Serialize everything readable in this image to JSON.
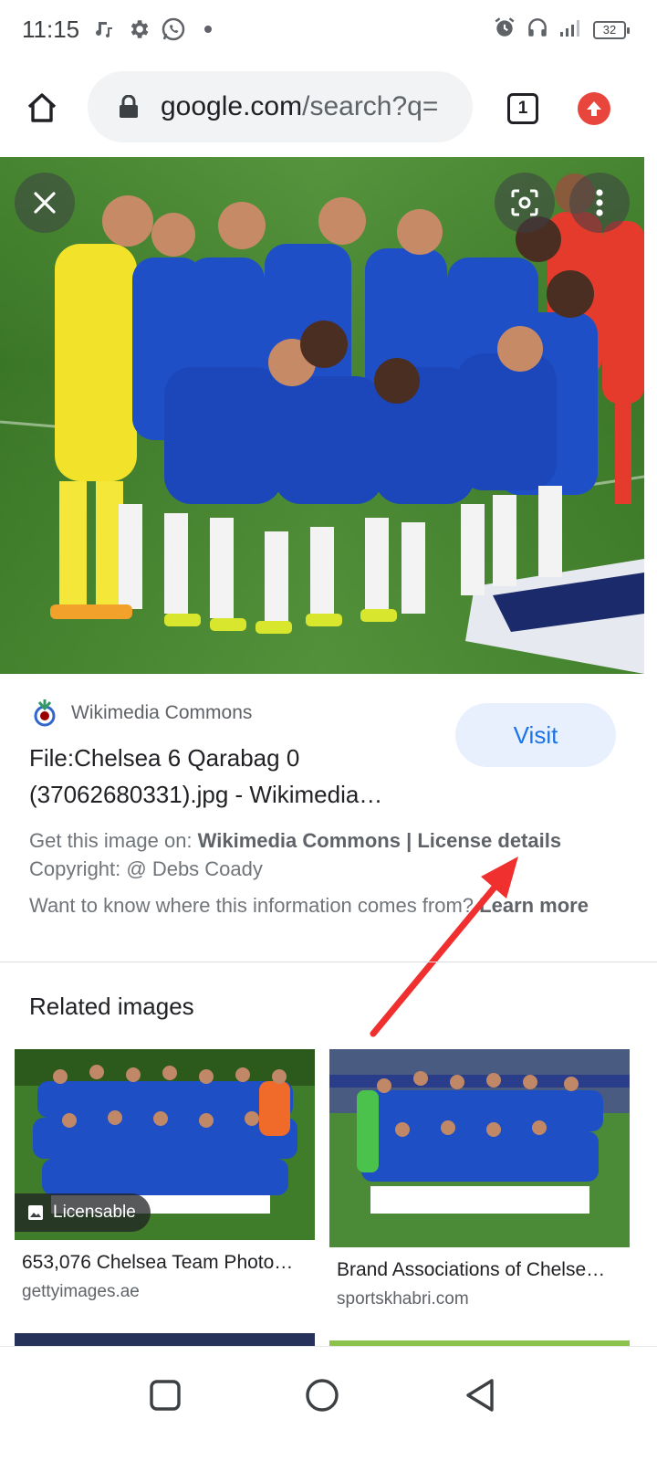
{
  "status_bar": {
    "time": "11:15",
    "battery": "32"
  },
  "browser": {
    "url_host": "google.com",
    "url_path": "/search?q=",
    "tab_count": "1"
  },
  "result": {
    "source_name": "Wikimedia Commons",
    "title": "File:Chelsea 6 Qarabag 0 (37062680331).jpg - Wikimedia…",
    "visit_label": "Visit",
    "get_image_prefix": "Get this image on: ",
    "get_image_source": "Wikimedia Commons",
    "separator": " | ",
    "license_link": "License details",
    "copyright": "Copyright: @ Debs Coady",
    "want_to_know": "Want to know where this information comes from? ",
    "learn_more": "Learn more"
  },
  "related": {
    "heading": "Related images",
    "items": [
      {
        "title": "653,076 Chelsea Team Photo…",
        "source": "gettyimages.ae",
        "badge": "Licensable"
      },
      {
        "title": "Brand Associations of Chelse…",
        "source": "sportskhabri.com"
      }
    ]
  },
  "colors": {
    "accent": "#1a73e8",
    "arrow": "#f0302e",
    "update_badge": "#e8453c"
  }
}
